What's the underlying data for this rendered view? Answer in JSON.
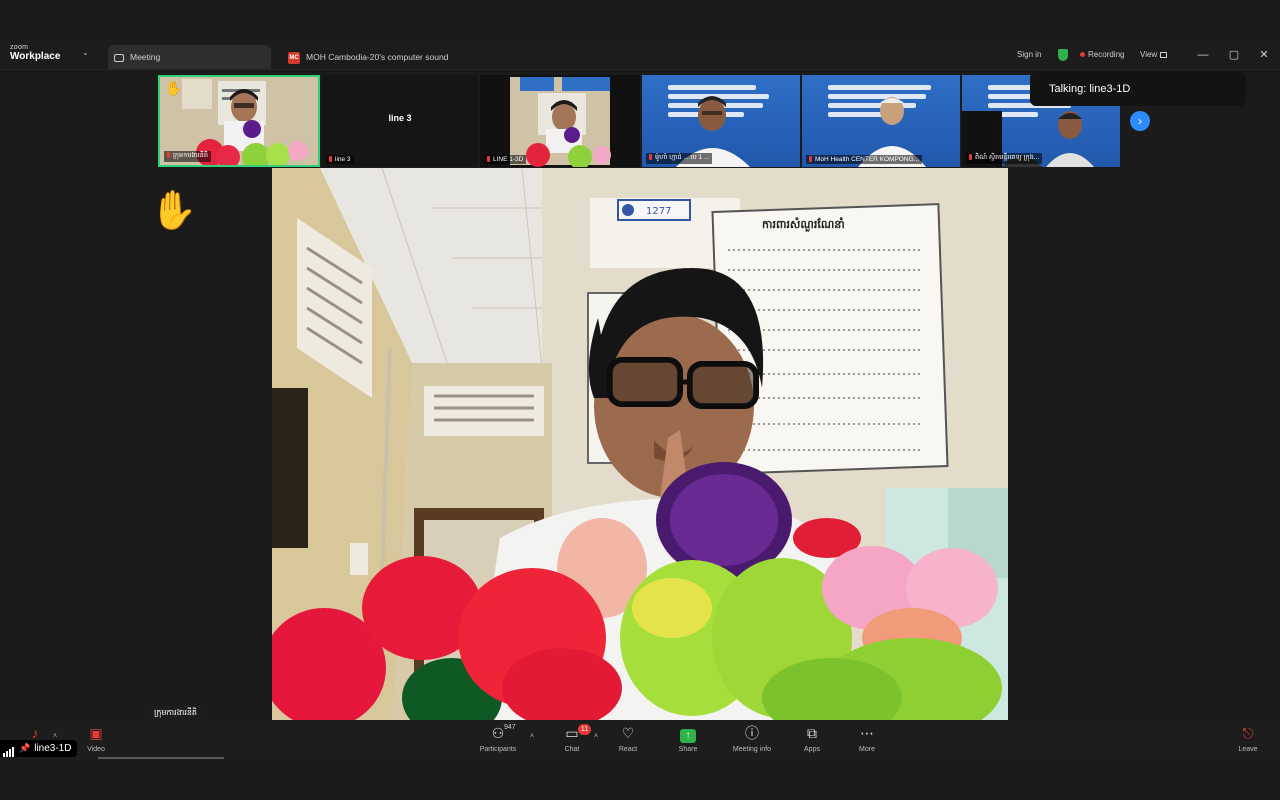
{
  "app": {
    "brand_small": "zoom",
    "brand": "Workplace",
    "tabs": [
      {
        "label": "Meeting",
        "active": true
      },
      {
        "label": "MOH Cambodia-20's computer sound",
        "icon_text": "MC"
      }
    ],
    "sign_in": "Sign in",
    "recording": "Recording",
    "view": "View",
    "window_controls": {
      "minimize": "—",
      "maximize": "▢",
      "close": "✕"
    }
  },
  "toast": {
    "text": "Talking: line3-1D"
  },
  "thumbnails": [
    {
      "name": "ក្រុមការងារនីតិ",
      "active": true,
      "raised_hand": true
    },
    {
      "name": "line 3",
      "center_text": "line 3"
    },
    {
      "name": "LINE 1-3D"
    },
    {
      "name": "ម៉ូហាំ ហ្មាដ់ ... រប 1 ..."
    },
    {
      "name": "MoH Health CENTER KOMPONG..."
    },
    {
      "name": "ពិណ៍ ស្ថិតមន្ទីរពេទ្យ ក្រុង..."
    }
  ],
  "strip_next": "›",
  "main_video": {
    "participant_label": "ក្រុមការងារនីតិ",
    "raised_hand": "✋",
    "poster_title": "ការពារសំណួរណែនាំ",
    "poster_sign": "1277"
  },
  "controls": {
    "audio": {
      "label": ""
    },
    "video": {
      "label": "Video"
    },
    "participants": {
      "label": "Participants",
      "count": "947"
    },
    "chat": {
      "label": "Chat",
      "badge": "11"
    },
    "react": {
      "label": "React"
    },
    "share": {
      "label": "Share"
    },
    "meeting_info": {
      "label": "Meeting info"
    },
    "apps": {
      "label": "Apps"
    },
    "more": {
      "label": "More"
    },
    "leave": {
      "label": "Leave"
    }
  },
  "self_view": {
    "name": "line3-1D"
  },
  "colors": {
    "accent_green": "#2fd17a",
    "record_red": "#e53935",
    "share_green": "#2fb24b",
    "next_blue": "#2d8cff"
  },
  "icons": [
    "meeting-icon",
    "shield-icon",
    "record-icon",
    "grid-icon",
    "hand-icon",
    "mic-muted-icon",
    "video-off-icon",
    "participants-icon",
    "chat-icon",
    "heart-icon",
    "share-icon",
    "info-icon",
    "apps-icon",
    "more-icon",
    "leave-icon",
    "signal-icon",
    "pin-icon"
  ]
}
